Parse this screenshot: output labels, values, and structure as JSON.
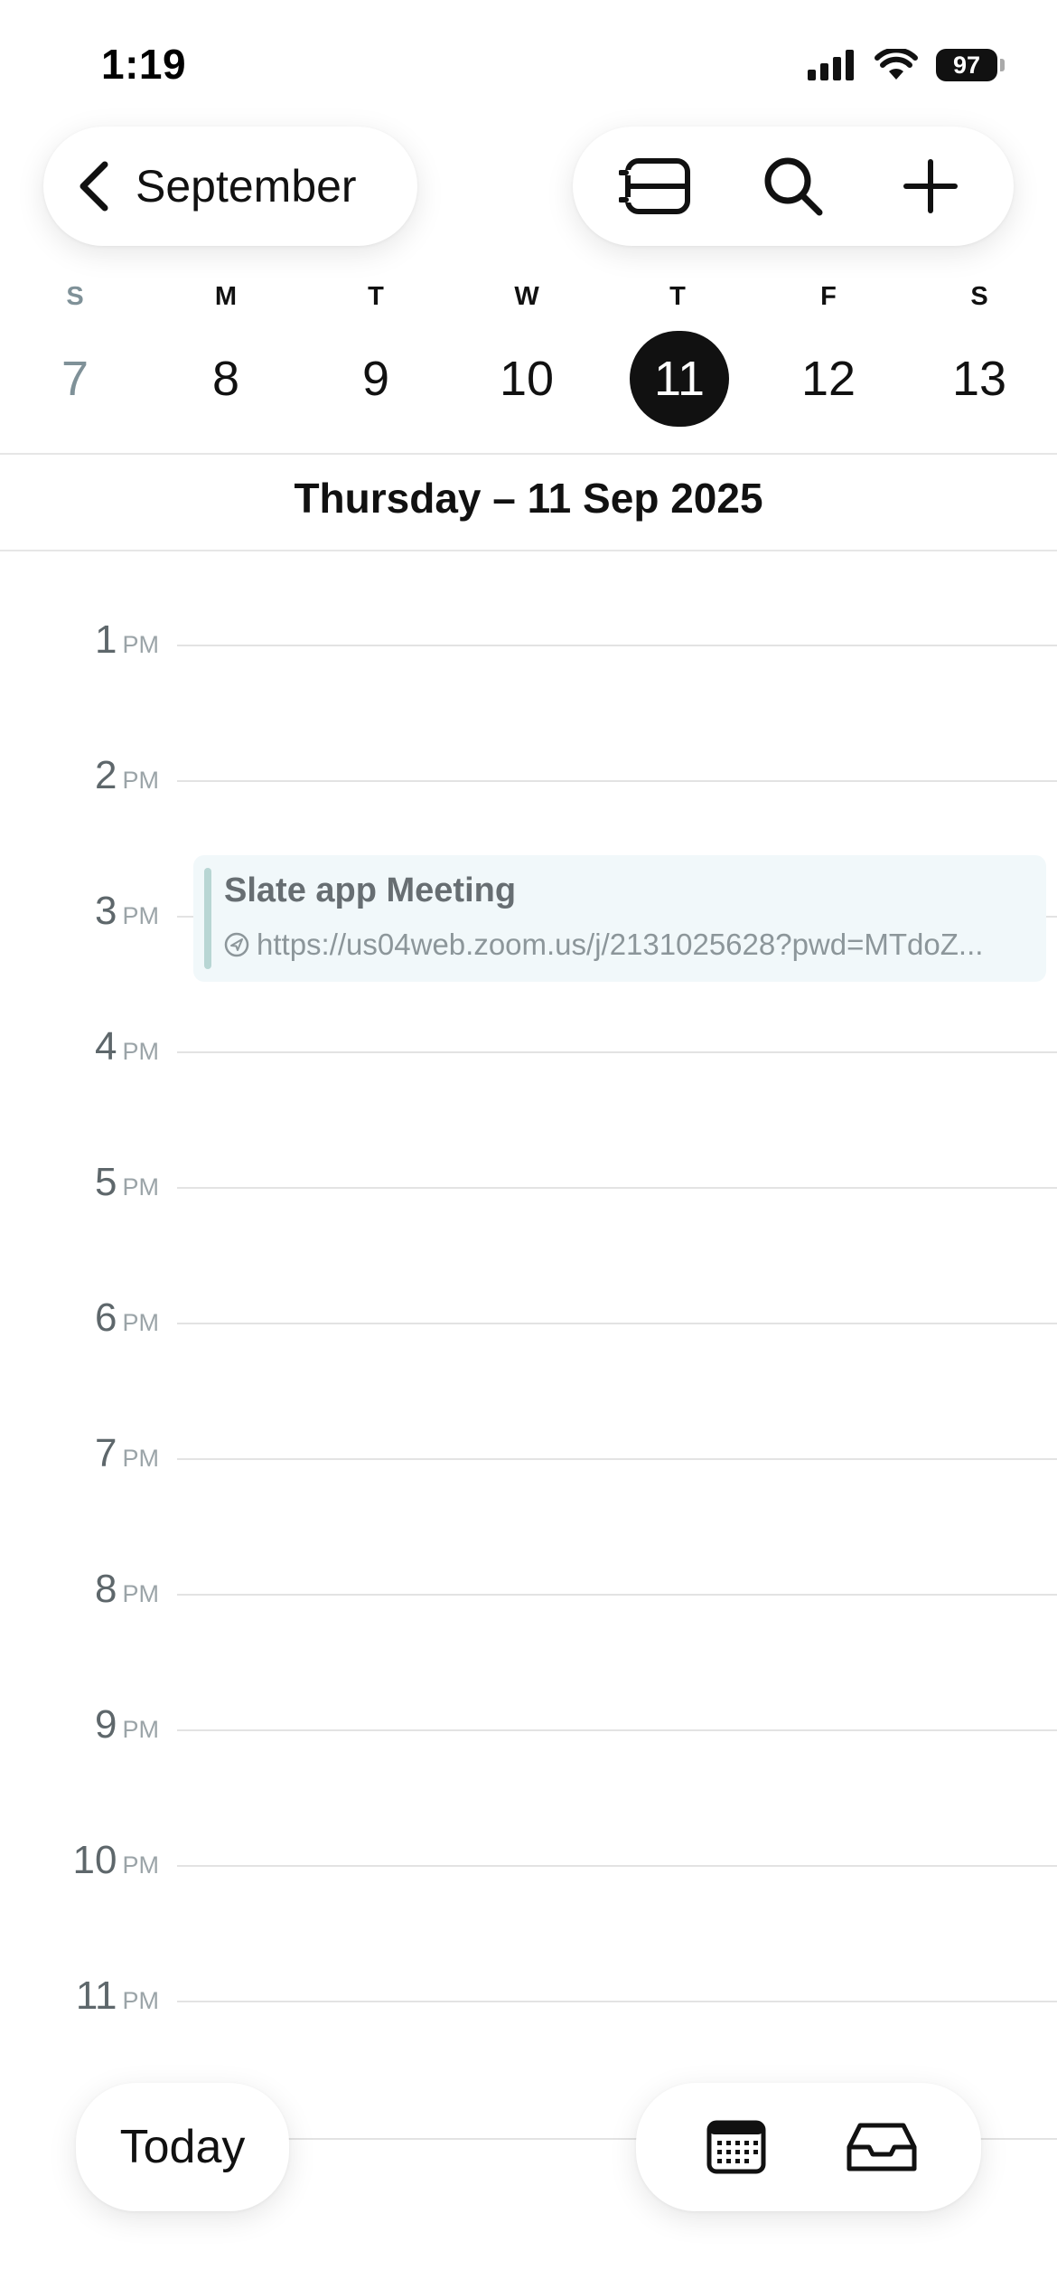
{
  "status_bar": {
    "time": "1:19",
    "battery": "97",
    "icons": [
      "signal-icon",
      "wifi-icon",
      "battery-icon"
    ]
  },
  "header": {
    "back_label": "September",
    "back_icon": "chevron-left-icon",
    "tools": [
      "list-view-icon",
      "search-icon",
      "plus-icon"
    ]
  },
  "week": {
    "days": [
      {
        "letter": "S",
        "num": "7",
        "state": "dim"
      },
      {
        "letter": "M",
        "num": "8",
        "state": "normal"
      },
      {
        "letter": "T",
        "num": "9",
        "state": "normal"
      },
      {
        "letter": "W",
        "num": "10",
        "state": "normal"
      },
      {
        "letter": "T",
        "num": "11",
        "state": "selected"
      },
      {
        "letter": "F",
        "num": "12",
        "state": "normal"
      },
      {
        "letter": "S",
        "num": "13",
        "state": "normal"
      }
    ]
  },
  "date_heading": "Thursday – 11 Sep 2025",
  "timeline": {
    "hours": [
      {
        "num": "1",
        "ampm": "PM"
      },
      {
        "num": "2",
        "ampm": "PM"
      },
      {
        "num": "3",
        "ampm": "PM"
      },
      {
        "num": "4",
        "ampm": "PM"
      },
      {
        "num": "5",
        "ampm": "PM"
      },
      {
        "num": "6",
        "ampm": "PM"
      },
      {
        "num": "7",
        "ampm": "PM"
      },
      {
        "num": "8",
        "ampm": "PM"
      },
      {
        "num": "9",
        "ampm": "PM"
      },
      {
        "num": "10",
        "ampm": "PM"
      },
      {
        "num": "11",
        "ampm": "PM"
      }
    ]
  },
  "event": {
    "title": "Slate app Meeting",
    "link": "https://us04web.zoom.us/j/2131025628?pwd=MTdoZ...",
    "bar_color": "#b8d6d4",
    "bg_color": "#f1f8fa"
  },
  "bottom_bar": {
    "today_label": "Today",
    "tools": [
      "calendar-icon",
      "inbox-icon"
    ]
  },
  "colors": {
    "accent": "#111111",
    "muted": "#7f9198"
  }
}
